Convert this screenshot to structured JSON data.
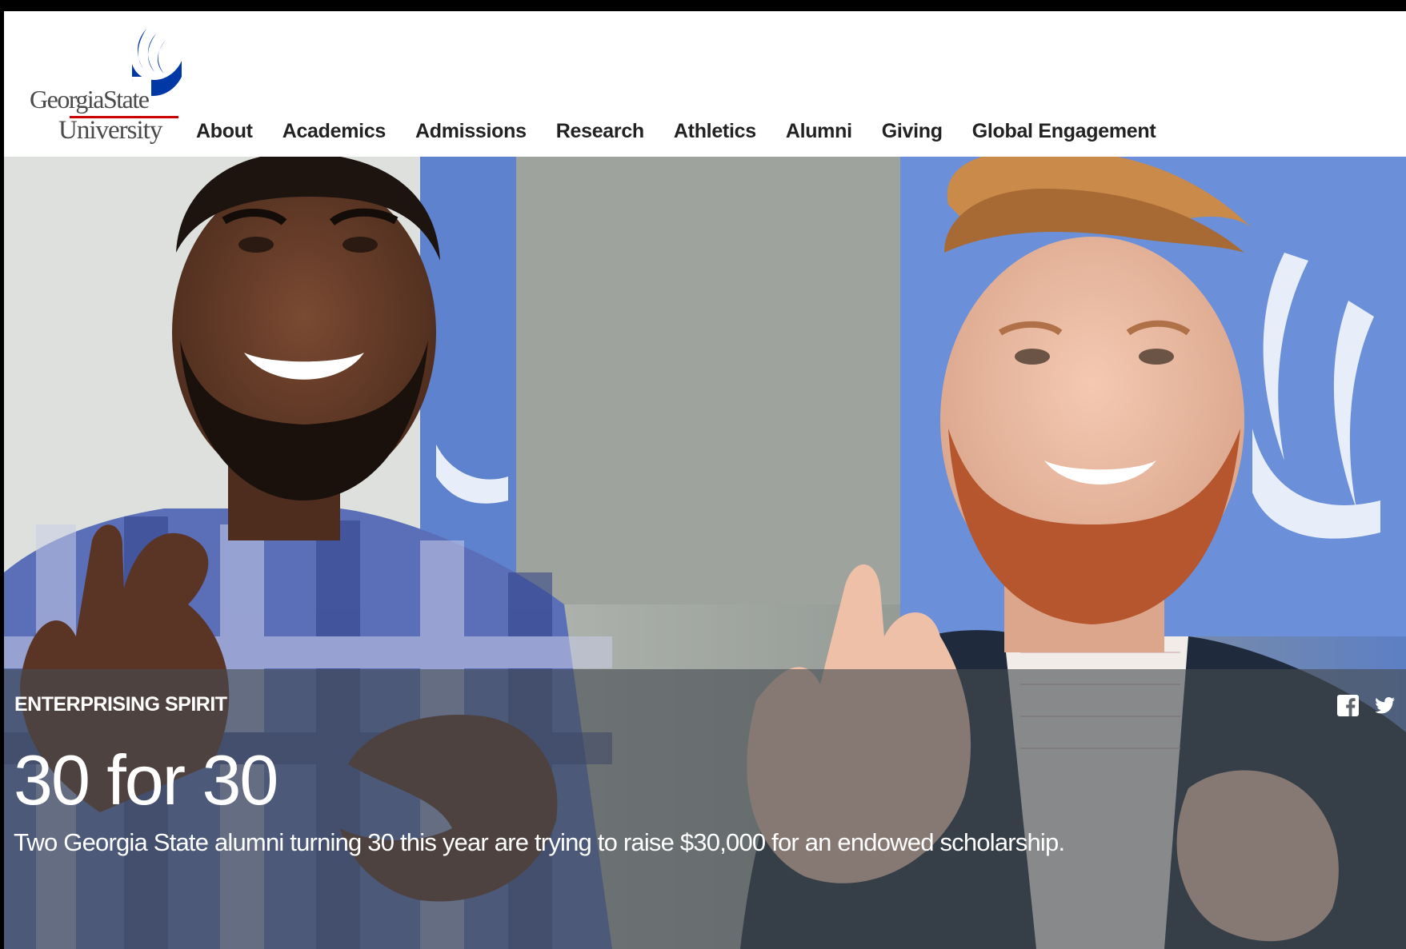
{
  "logo": {
    "line1": "GeorgiaState",
    "line2": "University"
  },
  "nav": {
    "items": [
      {
        "label": "About"
      },
      {
        "label": "Academics"
      },
      {
        "label": "Admissions"
      },
      {
        "label": "Research"
      },
      {
        "label": "Athletics"
      },
      {
        "label": "Alumni"
      },
      {
        "label": "Giving"
      },
      {
        "label": "Global Engagement"
      }
    ]
  },
  "hero": {
    "kicker": "ENTERPRISING SPIRIT",
    "headline": "30 for 30",
    "dek": "Two Georgia State alumni turning 30 this year are trying to raise $30,000 for an endowed scholarship."
  },
  "share": {
    "facebook_icon": "facebook-icon",
    "twitter_icon": "twitter-icon"
  },
  "colors": {
    "brand_blue": "#0039a6",
    "brand_red": "#cc0000",
    "nav_text": "#222222",
    "overlay": "#464c50"
  }
}
